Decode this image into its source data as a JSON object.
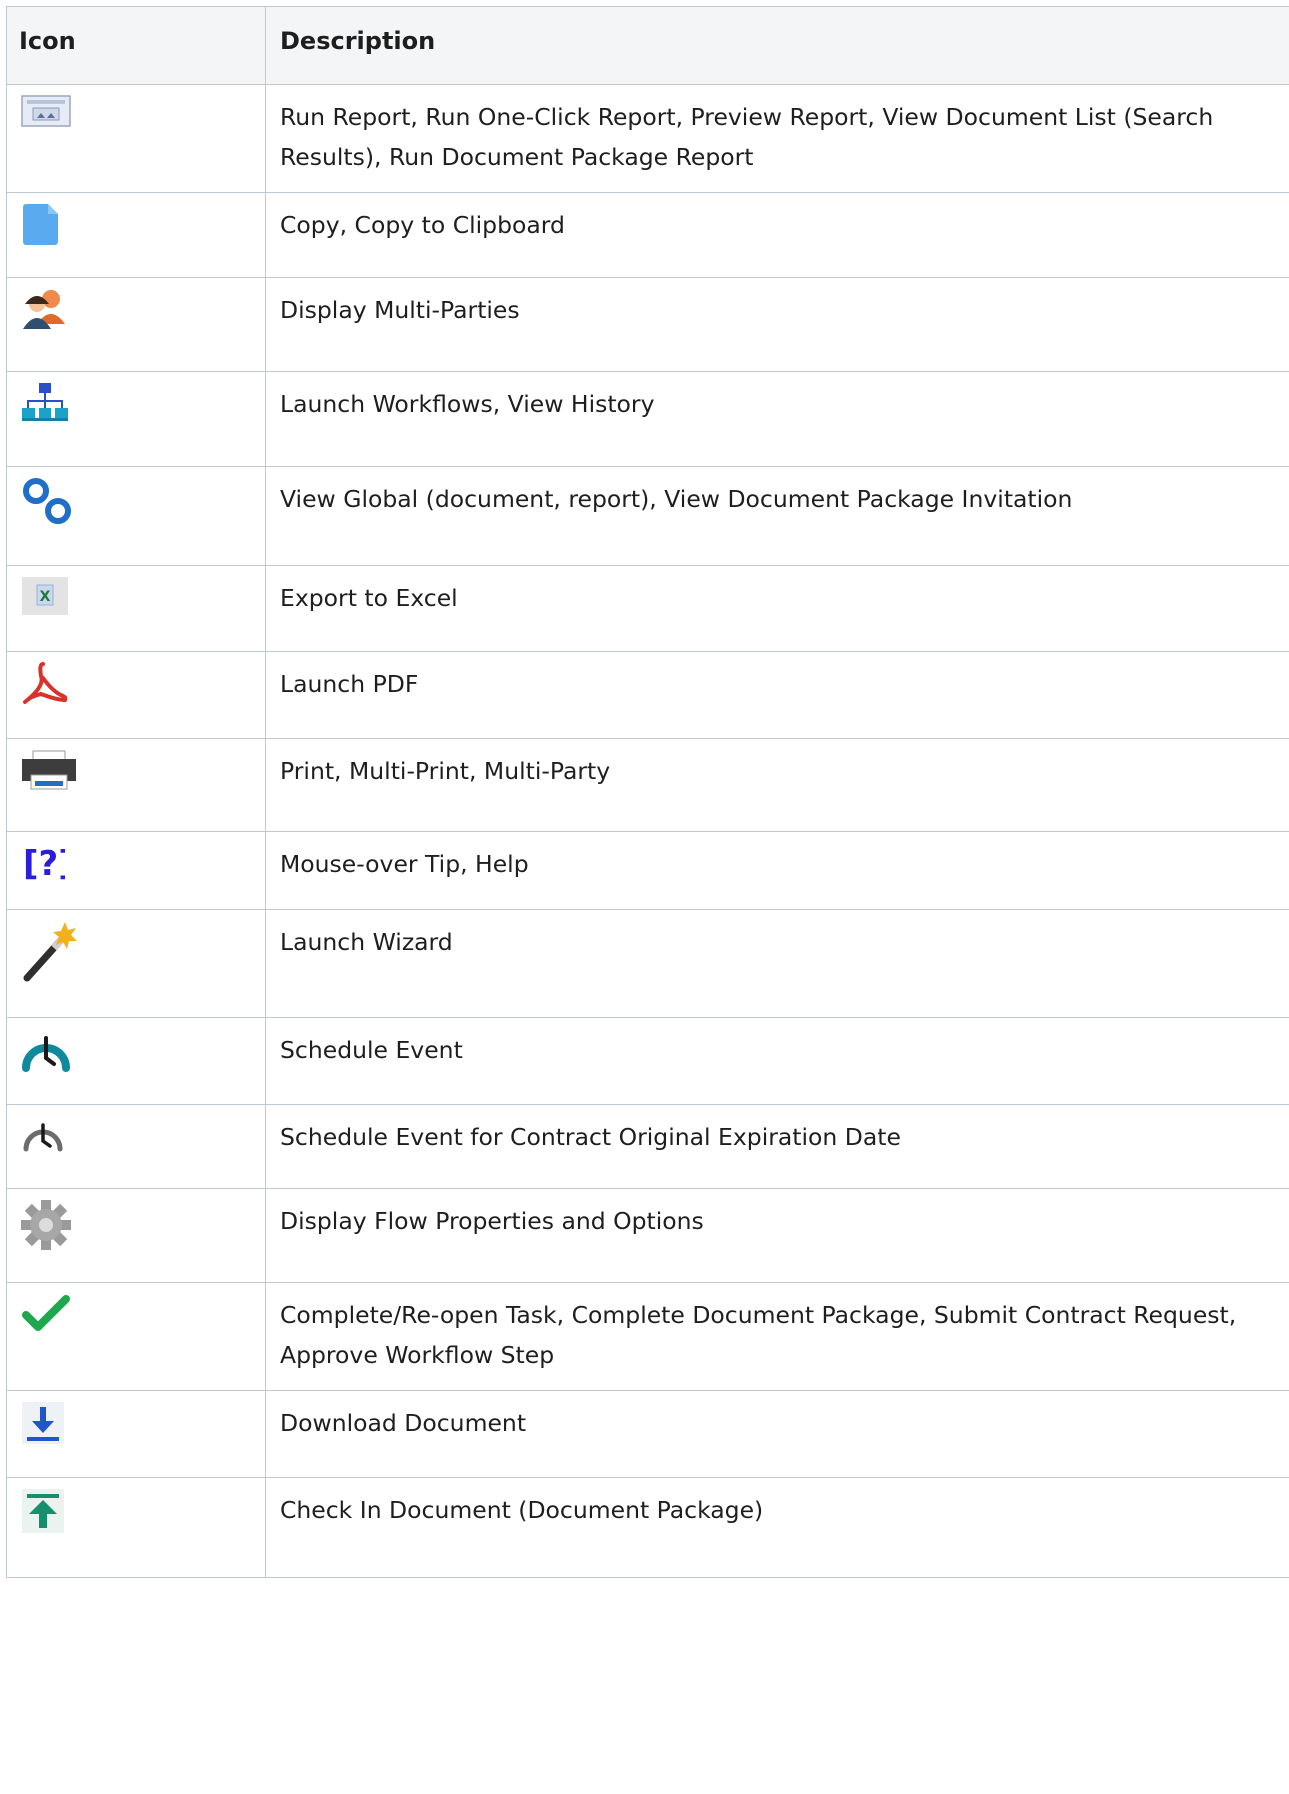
{
  "table": {
    "headers": {
      "icon": "Icon",
      "description": "Description"
    },
    "rows": [
      {
        "icon": "report-icon",
        "description": "Run Report, Run One-Click Report, Preview Report, View Document List (Search Results), Run Document Package Report"
      },
      {
        "icon": "copy-icon",
        "description": "Copy, Copy to Clipboard"
      },
      {
        "icon": "multi-parties-icon",
        "description": "Display Multi-Parties"
      },
      {
        "icon": "workflow-icon",
        "description": "Launch Workflows, View History"
      },
      {
        "icon": "global-link-icon",
        "description": "View Global (document, report), View Document Package Invitation"
      },
      {
        "icon": "excel-icon",
        "description": "Export to Excel"
      },
      {
        "icon": "pdf-icon",
        "description": "Launch PDF"
      },
      {
        "icon": "print-icon",
        "description": "Print, Multi-Print, Multi-Party"
      },
      {
        "icon": "help-icon",
        "description": "Mouse-over Tip, Help"
      },
      {
        "icon": "wizard-wand-icon",
        "description": "Launch Wizard"
      },
      {
        "icon": "schedule-event-icon",
        "description": "Schedule Event"
      },
      {
        "icon": "schedule-expiration-icon",
        "description": "Schedule Event for Contract Original Expiration Date"
      },
      {
        "icon": "gear-icon",
        "description": "Display Flow Properties and Options"
      },
      {
        "icon": "checkmark-icon",
        "description": "Complete/Re-open Task, Complete Document Package, Submit Contract Request, Approve Workflow Step"
      },
      {
        "icon": "download-icon",
        "description": "Download Document"
      },
      {
        "icon": "check-in-icon",
        "description": "Check In Document (Document Package)"
      }
    ]
  },
  "colors": {
    "border": "#c1c7d0",
    "header_bg": "#f4f5f7",
    "text": "#1e1e1e",
    "copy_blue": "#5aaaf0",
    "workflow_teal": "#1aa3c8",
    "link_blue": "#1f6fc9",
    "pdf_red": "#d9322b",
    "help_blue": "#2a1fd6",
    "check_green": "#1ea84e",
    "arrow_teal": "#16906a"
  }
}
